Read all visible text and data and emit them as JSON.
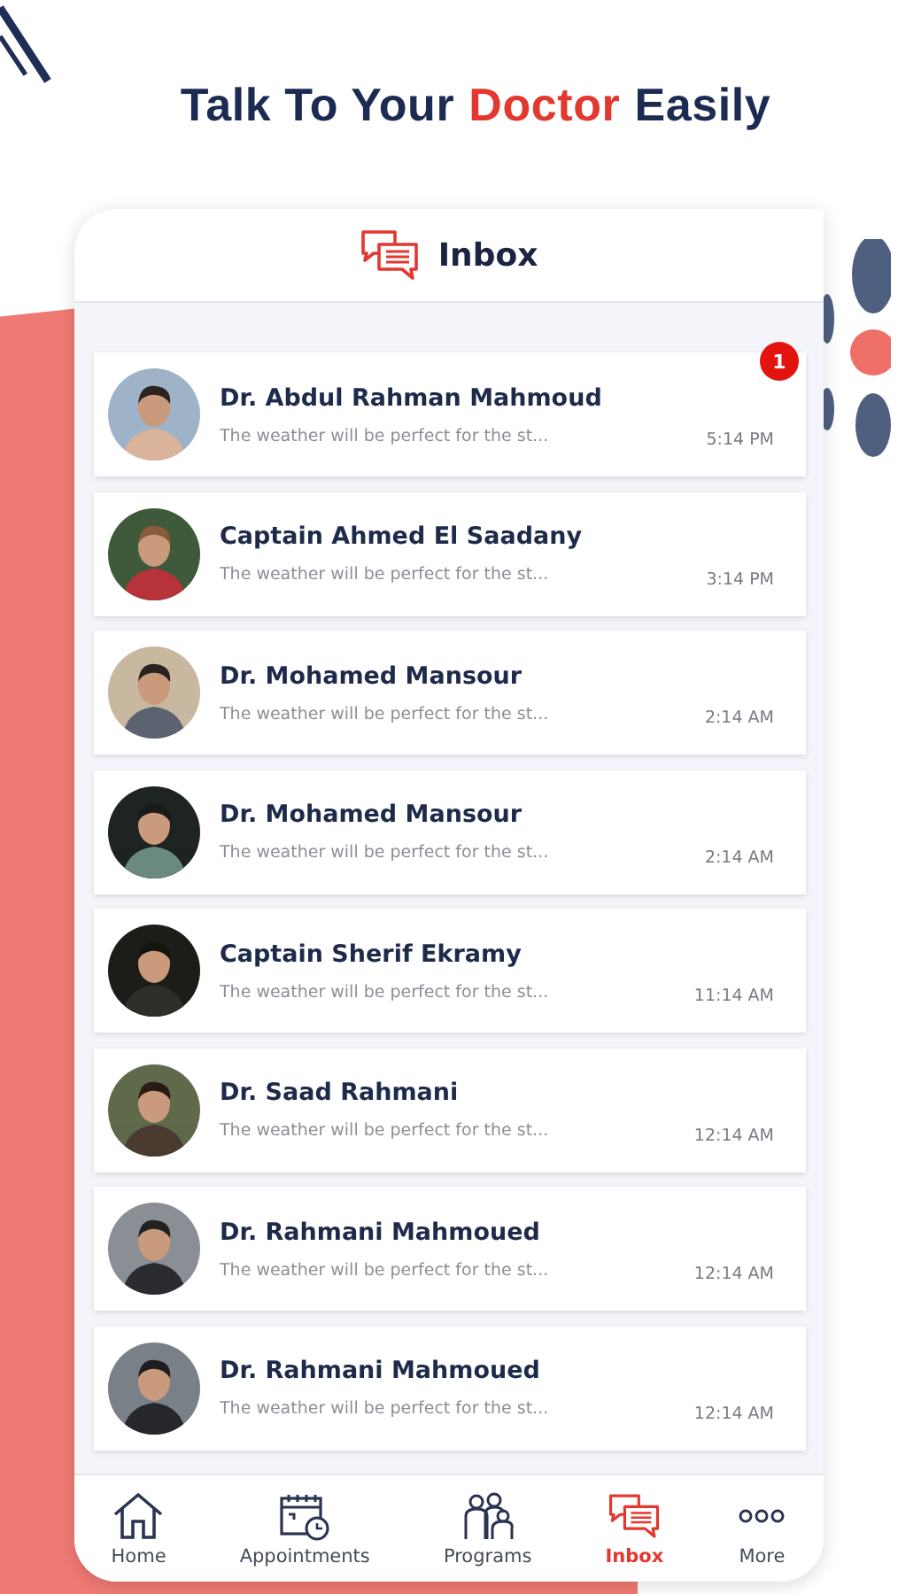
{
  "headline": [
    {
      "text": "Talk To Your",
      "highlight": false
    },
    {
      "text": "Doctor",
      "highlight": true
    },
    {
      "text": "Easily",
      "highlight": false
    }
  ],
  "header": {
    "title": "Inbox"
  },
  "conversations": [
    {
      "name": "Dr. Abdul Rahman Mahmoud",
      "preview": "The weather will be perfect for the st...",
      "time": "5:14 PM",
      "unread": "1"
    },
    {
      "name": "Captain Ahmed El Saadany",
      "preview": "The weather will be perfect for the st...",
      "time": "3:14 PM"
    },
    {
      "name": "Dr. Mohamed Mansour",
      "preview": "The weather will be perfect for the st...",
      "time": "2:14 AM"
    },
    {
      "name": "Dr. Mohamed Mansour",
      "preview": "The weather will be perfect for the st...",
      "time": "2:14 AM"
    },
    {
      "name": "Captain Sherif Ekramy",
      "preview": "The weather will be perfect for the st...",
      "time": "11:14 AM"
    },
    {
      "name": "Dr. Saad Rahmani",
      "preview": "The weather will be perfect for the st...",
      "time": "12:14 AM"
    },
    {
      "name": "Dr. Rahmani Mahmoued",
      "preview": "The weather will be perfect for the st...",
      "time": "12:14 AM"
    },
    {
      "name": "Dr. Rahmani Mahmoued",
      "preview": "The weather will be perfect for the st...",
      "time": "12:14 AM"
    }
  ],
  "tab_bar": [
    {
      "label": "Home",
      "kind": "home",
      "selected": false
    },
    {
      "label": "Appointments",
      "kind": "calendar",
      "selected": false
    },
    {
      "label": "Programs",
      "kind": "people",
      "selected": false
    },
    {
      "label": "Inbox",
      "kind": "chat",
      "selected": true
    },
    {
      "label": "More",
      "kind": "more",
      "selected": false
    }
  ]
}
